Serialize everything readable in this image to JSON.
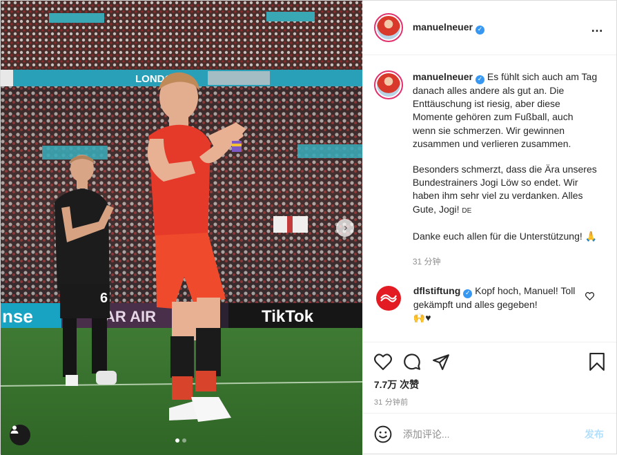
{
  "post": {
    "author": "manuelneuer",
    "verified_mark": "✓",
    "more_icon": "…",
    "photo": {
      "carousel_dots": 2,
      "active_dot": 0,
      "stadium_banner": "LONDON",
      "ad_left": "nse",
      "ad_middle": "AR AIR",
      "ad_right": "TikTok",
      "player_number": "6"
    }
  },
  "caption": {
    "username": "manuelneuer",
    "paragraph1": "Es fühlt sich auch am Tag danach alles andere als gut an. Die Enttäuschung ist riesig, aber diese Momente gehören zum Fußball, auch wenn sie schmerzen. Wir gewinnen zusammen und verlieren zusammen.",
    "paragraph2": "Besonders schmerzt, dass die Ära unseres Bundestrainers Jogi Löw so endet. Wir haben ihm sehr viel zu verdanken. Alles Gute, Jogi!",
    "flag": "DE",
    "paragraph3": "Danke euch allen für die Unterstützung! 🙏",
    "time": "31 分钟"
  },
  "comment": {
    "username": "dflstiftung",
    "text": "Kopf hoch, Manuel! Toll gekämpft und alles gegeben!",
    "emoji": "🙌♥"
  },
  "actions": {
    "likes": "7.7万 次赞",
    "posted": "31 分钟前"
  },
  "add_comment": {
    "placeholder": "添加评论...",
    "post_label": "发布"
  },
  "colors": {
    "accent": "#3897f0",
    "post_button_disabled": "#b2dffc",
    "muted": "#8e8e8e",
    "text": "#262626",
    "dfl_red": "#e31b23"
  }
}
